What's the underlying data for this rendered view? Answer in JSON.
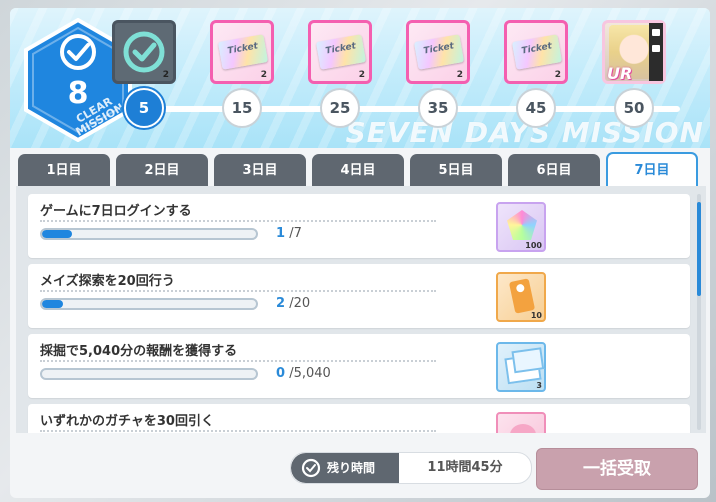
{
  "header": {
    "clear_count": "8",
    "clear_label": "CLEAR MISSION",
    "banner_text": "SEVEN DAYS MISSION",
    "progress_fraction": 0.06,
    "milestones": [
      {
        "value": "5",
        "achieved": true
      },
      {
        "value": "15",
        "achieved": false
      },
      {
        "value": "25",
        "achieved": false
      },
      {
        "value": "35",
        "achieved": false
      },
      {
        "value": "45",
        "achieved": false
      },
      {
        "value": "50",
        "achieved": false
      }
    ],
    "rewards": [
      {
        "type": "claimed",
        "icon": "check-icon",
        "count": "2"
      },
      {
        "type": "ticket",
        "icon": "ticket-icon",
        "label": "Ticket",
        "count": "2"
      },
      {
        "type": "ticket",
        "icon": "ticket-icon",
        "label": "Ticket",
        "count": "2"
      },
      {
        "type": "ticket",
        "icon": "ticket-icon",
        "label": "Ticket",
        "count": "2"
      },
      {
        "type": "ticket",
        "icon": "ticket-icon",
        "label": "Ticket",
        "count": "2"
      },
      {
        "type": "character",
        "icon": "character-portrait",
        "badge": "UR"
      }
    ]
  },
  "tabs": [
    {
      "label": "1日目",
      "active": false
    },
    {
      "label": "2日目",
      "active": false
    },
    {
      "label": "3日目",
      "active": false
    },
    {
      "label": "4日目",
      "active": false
    },
    {
      "label": "5日目",
      "active": false
    },
    {
      "label": "6日目",
      "active": false
    },
    {
      "label": "7日目",
      "active": true
    }
  ],
  "missions": [
    {
      "title": "ゲームに7日ログインする",
      "current": "1",
      "total": "/7",
      "progress": 0.14,
      "reward_icon": "rainbow-gem-icon",
      "reward_count": "100"
    },
    {
      "title": "メイズ探索を20回行う",
      "current": "2",
      "total": "/20",
      "progress": 0.1,
      "reward_icon": "orange-tag-icon",
      "reward_count": "10"
    },
    {
      "title": "採掘で5,040分の報酬を獲得する",
      "current": "0",
      "total": "/5,040",
      "progress": 0.0,
      "reward_icon": "card-stack-icon",
      "reward_count": "3"
    },
    {
      "title": "いずれかのガチャを30回引く",
      "current": "",
      "total": "",
      "progress": 0.0,
      "reward_icon": "pink-pig-icon",
      "reward_count": ""
    }
  ],
  "footer": {
    "timer_label": "残り時間",
    "timer_value": "11時間45分",
    "claim_all_label": "一括受取"
  },
  "colors": {
    "accent": "#1e7fd6",
    "tab_inactive": "#5f6770",
    "claim_disabled": "#c9a1ad",
    "reward_border": "#f45fb0"
  }
}
